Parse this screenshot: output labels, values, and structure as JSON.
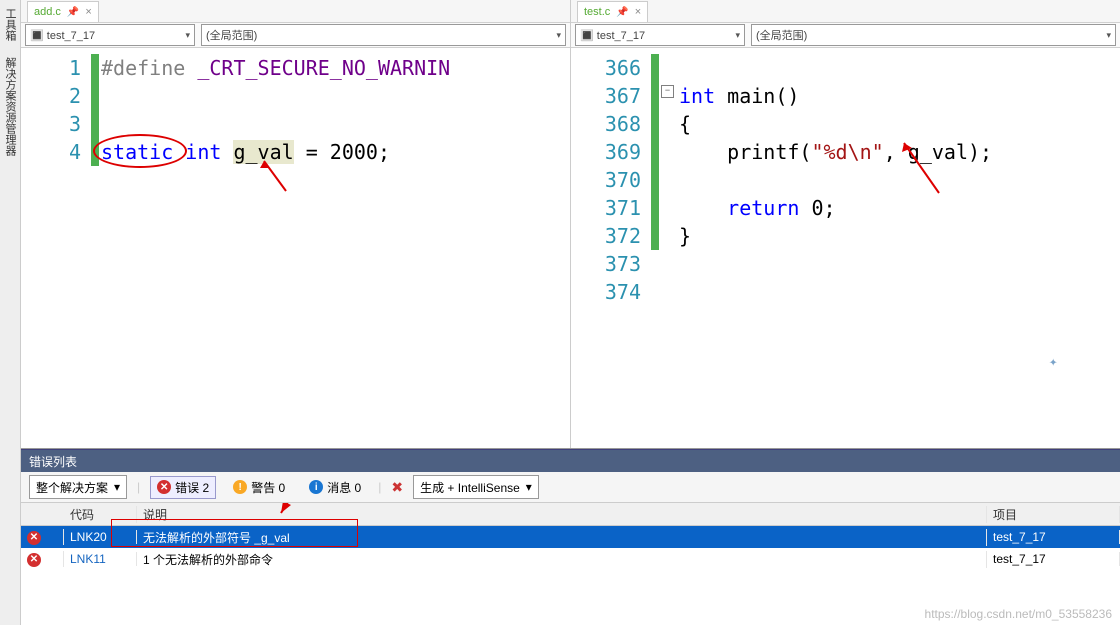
{
  "rail": {
    "toolbox": "工具箱",
    "solution": "解决方案资源管理器"
  },
  "left": {
    "tab": "add.c",
    "combo1": "test_7_17",
    "combo2": "(全局范围)",
    "lines": [
      "1",
      "2",
      "3",
      "4"
    ],
    "code": {
      "pp": "#define ",
      "macro": "_CRT_SECURE_NO_WARNIN",
      "kw_static": "static",
      "kw_int": "int",
      "var": "g_val",
      "rest": " = 2000;"
    }
  },
  "right": {
    "tab": "test.c",
    "combo1": "test_7_17",
    "combo2": "(全局范围)",
    "lines": [
      "366",
      "367",
      "368",
      "369",
      "370",
      "371",
      "372",
      "373",
      "374"
    ],
    "code": {
      "kw_int": "int",
      "main": " main()",
      "ob": "{",
      "printf_name": "printf",
      "printf_open": "(",
      "printf_fmt": "\"%d\\n\"",
      "printf_rest": ", g_val);",
      "ret": "return",
      "ret_rest": " 0;",
      "cb": "}"
    }
  },
  "err": {
    "title": "错误列表",
    "scope": "整个解决方案",
    "err_label": "错误 2",
    "warn_label": "警告 0",
    "info_label": "消息 0",
    "build": "生成 + IntelliSense",
    "hdr": {
      "code": "代码",
      "desc": "说明",
      "proj": "项目"
    },
    "rows": [
      {
        "code": "LNK20",
        "desc": "无法解析的外部符号 _g_val",
        "proj": "test_7_17"
      },
      {
        "code": "LNK11",
        "desc": "1 个无法解析的外部命令",
        "proj": "test_7_17"
      }
    ]
  },
  "watermark": "https://blog.csdn.net/m0_53558236"
}
